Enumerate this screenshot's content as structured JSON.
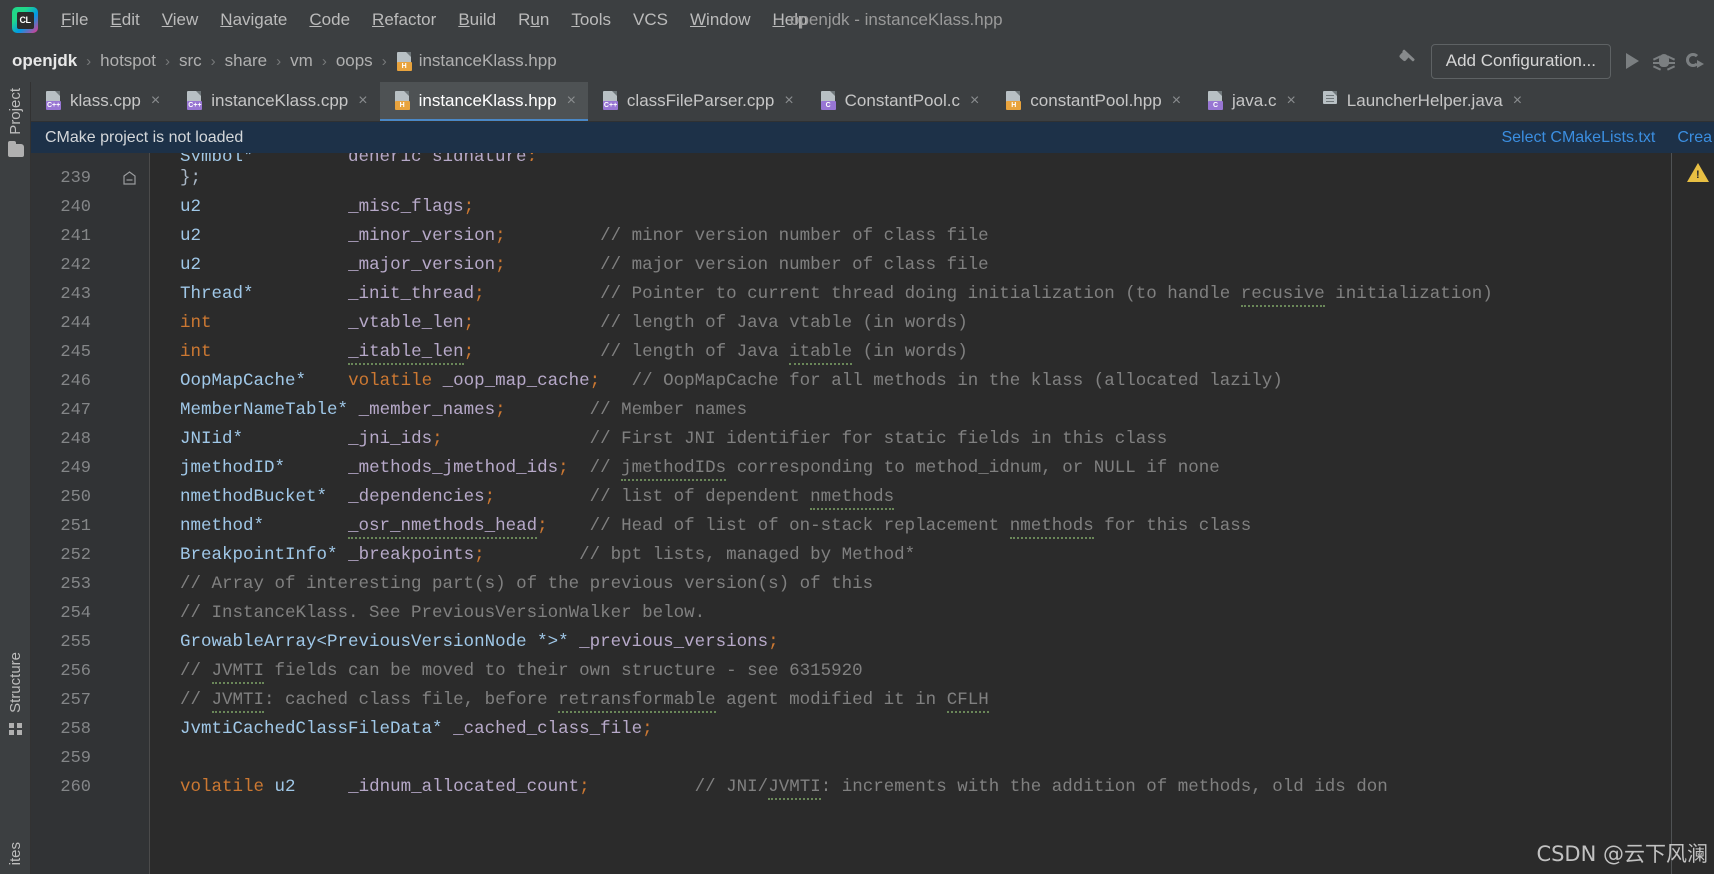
{
  "app": {
    "logo_text": "CL",
    "window_title": "openjdk - instanceKlass.hpp"
  },
  "menubar": {
    "items": [
      {
        "label": "File",
        "mnemonic": "F"
      },
      {
        "label": "Edit",
        "mnemonic": "E"
      },
      {
        "label": "View",
        "mnemonic": "V"
      },
      {
        "label": "Navigate",
        "mnemonic": "N"
      },
      {
        "label": "Code",
        "mnemonic": "C"
      },
      {
        "label": "Refactor",
        "mnemonic": "R"
      },
      {
        "label": "Build",
        "mnemonic": "B"
      },
      {
        "label": "Run",
        "mnemonic": "u"
      },
      {
        "label": "Tools",
        "mnemonic": "T"
      },
      {
        "label": "VCS",
        "mnemonic": ""
      },
      {
        "label": "Window",
        "mnemonic": "W"
      },
      {
        "label": "Help",
        "mnemonic": "H"
      }
    ]
  },
  "breadcrumb": {
    "separator": "›",
    "items": [
      "openjdk",
      "hotspot",
      "src",
      "share",
      "vm",
      "oops"
    ],
    "file": "instanceKlass.hpp",
    "file_icon": "h-file-icon"
  },
  "toolbar": {
    "build_icon": "hammer-icon",
    "add_configuration": "Add Configuration...",
    "run_icon": "run-icon",
    "debug_icon": "debug-bug-icon",
    "coverage_icon": "run-with-coverage-icon"
  },
  "tool_strip": {
    "project": "Project",
    "structure": "Structure",
    "favorites": "ites"
  },
  "tabs": [
    {
      "label": "klass.cpp",
      "icon": "cpp-file-icon",
      "badge": "C++",
      "badge_class": "cpp",
      "active": false
    },
    {
      "label": "instanceKlass.cpp",
      "icon": "cpp-file-icon",
      "badge": "C++",
      "badge_class": "cpp",
      "active": false
    },
    {
      "label": "instanceKlass.hpp",
      "icon": "h-file-icon",
      "badge": "H",
      "badge_class": "h",
      "active": true
    },
    {
      "label": "classFileParser.cpp",
      "icon": "cpp-file-icon",
      "badge": "C++",
      "badge_class": "cpp",
      "active": false
    },
    {
      "label": "ConstantPool.c",
      "icon": "c-file-icon",
      "badge": "C",
      "badge_class": "c",
      "active": false
    },
    {
      "label": "constantPool.hpp",
      "icon": "h-file-icon",
      "badge": "H",
      "badge_class": "h",
      "active": false
    },
    {
      "label": "java.c",
      "icon": "c-file-icon",
      "badge": "C",
      "badge_class": "c",
      "active": false
    },
    {
      "label": "LauncherHelper.java",
      "icon": "java-file-icon",
      "badge": "",
      "badge_class": "java",
      "active": false
    }
  ],
  "tab_close_glyph": "×",
  "notification": {
    "message": "CMake project is not loaded",
    "actions": [
      "Select CMakeLists.txt",
      "Crea"
    ]
  },
  "editor": {
    "first_line": 239,
    "fold_marker_line": 239,
    "warning_icon": "warning-triangle-icon",
    "lines": [
      {
        "num": 239,
        "fold": true,
        "tokens": [
          {
            "t": "  };",
            "c": "pn"
          }
        ]
      },
      {
        "num": 240,
        "tokens": [
          {
            "t": "  ",
            "c": "pn"
          },
          {
            "t": "u2",
            "c": "ty"
          },
          {
            "t": "              ",
            "c": "pn"
          },
          {
            "t": "_misc_flags",
            "c": "id"
          },
          {
            "t": ";",
            "c": "sc"
          }
        ]
      },
      {
        "num": 241,
        "tokens": [
          {
            "t": "  ",
            "c": "pn"
          },
          {
            "t": "u2",
            "c": "ty"
          },
          {
            "t": "              ",
            "c": "pn"
          },
          {
            "t": "_minor_version",
            "c": "id"
          },
          {
            "t": ";",
            "c": "sc"
          },
          {
            "t": "         ",
            "c": "pn"
          },
          {
            "t": "// minor version number of class file",
            "c": "cm"
          }
        ]
      },
      {
        "num": 242,
        "tokens": [
          {
            "t": "  ",
            "c": "pn"
          },
          {
            "t": "u2",
            "c": "ty"
          },
          {
            "t": "              ",
            "c": "pn"
          },
          {
            "t": "_major_version",
            "c": "id"
          },
          {
            "t": ";",
            "c": "sc"
          },
          {
            "t": "         ",
            "c": "pn"
          },
          {
            "t": "// major version number of class file",
            "c": "cm"
          }
        ]
      },
      {
        "num": 243,
        "tokens": [
          {
            "t": "  ",
            "c": "pn"
          },
          {
            "t": "Thread*",
            "c": "ty"
          },
          {
            "t": "         ",
            "c": "pn"
          },
          {
            "t": "_init_thread",
            "c": "id"
          },
          {
            "t": ";",
            "c": "sc"
          },
          {
            "t": "           ",
            "c": "pn"
          },
          {
            "t": "// Pointer to current thread doing initialization (to handle ",
            "c": "cm"
          },
          {
            "t": "recusive",
            "c": "cm sqc"
          },
          {
            "t": " initialization)",
            "c": "cm"
          }
        ]
      },
      {
        "num": 244,
        "tokens": [
          {
            "t": "  ",
            "c": "pn"
          },
          {
            "t": "int",
            "c": "k"
          },
          {
            "t": "             ",
            "c": "pn"
          },
          {
            "t": "_vtable_len",
            "c": "id"
          },
          {
            "t": ";",
            "c": "sc"
          },
          {
            "t": "            ",
            "c": "pn"
          },
          {
            "t": "// length of Java vtable (in words)",
            "c": "cm"
          }
        ]
      },
      {
        "num": 245,
        "tokens": [
          {
            "t": "  ",
            "c": "pn"
          },
          {
            "t": "int",
            "c": "k"
          },
          {
            "t": "             ",
            "c": "pn"
          },
          {
            "t": "_itable_len",
            "c": "id sq"
          },
          {
            "t": ";",
            "c": "sc"
          },
          {
            "t": "            ",
            "c": "pn"
          },
          {
            "t": "// length of Java ",
            "c": "cm"
          },
          {
            "t": "itable",
            "c": "cm sqc"
          },
          {
            "t": " (in words)",
            "c": "cm"
          }
        ]
      },
      {
        "num": 246,
        "tokens": [
          {
            "t": "  ",
            "c": "pn"
          },
          {
            "t": "OopMapCache*",
            "c": "ty"
          },
          {
            "t": "    ",
            "c": "pn"
          },
          {
            "t": "volatile",
            "c": "k"
          },
          {
            "t": " ",
            "c": "pn"
          },
          {
            "t": "_oop_map_cache",
            "c": "id"
          },
          {
            "t": ";",
            "c": "sc"
          },
          {
            "t": "   ",
            "c": "pn"
          },
          {
            "t": "// OopMapCache for all methods in the klass (allocated lazily)",
            "c": "cm"
          }
        ]
      },
      {
        "num": 247,
        "tokens": [
          {
            "t": "  ",
            "c": "pn"
          },
          {
            "t": "MemberNameTable*",
            "c": "ty"
          },
          {
            "t": " ",
            "c": "pn"
          },
          {
            "t": "_member_names",
            "c": "id"
          },
          {
            "t": ";",
            "c": "sc"
          },
          {
            "t": "        ",
            "c": "pn"
          },
          {
            "t": "// Member names",
            "c": "cm"
          }
        ]
      },
      {
        "num": 248,
        "tokens": [
          {
            "t": "  ",
            "c": "pn"
          },
          {
            "t": "JNIid*",
            "c": "ty"
          },
          {
            "t": "          ",
            "c": "pn"
          },
          {
            "t": "_jni_ids",
            "c": "id"
          },
          {
            "t": ";",
            "c": "sc"
          },
          {
            "t": "              ",
            "c": "pn"
          },
          {
            "t": "// First JNI identifier for static fields in this class",
            "c": "cm"
          }
        ]
      },
      {
        "num": 249,
        "tokens": [
          {
            "t": "  ",
            "c": "pn"
          },
          {
            "t": "jmethodID*",
            "c": "ty"
          },
          {
            "t": "      ",
            "c": "pn"
          },
          {
            "t": "_methods_jmethod_ids",
            "c": "id"
          },
          {
            "t": ";",
            "c": "sc"
          },
          {
            "t": "  ",
            "c": "pn"
          },
          {
            "t": "// ",
            "c": "cm"
          },
          {
            "t": "jmethodIDs",
            "c": "cm sqc"
          },
          {
            "t": " corresponding to method_idnum, or NULL if none",
            "c": "cm"
          }
        ]
      },
      {
        "num": 250,
        "tokens": [
          {
            "t": "  ",
            "c": "pn"
          },
          {
            "t": "nmethodBucket*",
            "c": "ty"
          },
          {
            "t": "  ",
            "c": "pn"
          },
          {
            "t": "_dependencies",
            "c": "id"
          },
          {
            "t": ";",
            "c": "sc"
          },
          {
            "t": "         ",
            "c": "pn"
          },
          {
            "t": "// list of dependent ",
            "c": "cm"
          },
          {
            "t": "nmethods",
            "c": "cm sqc"
          }
        ]
      },
      {
        "num": 251,
        "tokens": [
          {
            "t": "  ",
            "c": "pn"
          },
          {
            "t": "nmethod*",
            "c": "ty"
          },
          {
            "t": "        ",
            "c": "pn"
          },
          {
            "t": "_osr_nmethods_head",
            "c": "id sq"
          },
          {
            "t": ";",
            "c": "sc"
          },
          {
            "t": "    ",
            "c": "pn"
          },
          {
            "t": "// Head of list of on-stack replacement ",
            "c": "cm"
          },
          {
            "t": "nmethods",
            "c": "cm sqc"
          },
          {
            "t": " for this class",
            "c": "cm"
          }
        ]
      },
      {
        "num": 252,
        "tokens": [
          {
            "t": "  ",
            "c": "pn"
          },
          {
            "t": "BreakpointInfo*",
            "c": "ty"
          },
          {
            "t": " ",
            "c": "pn"
          },
          {
            "t": "_breakpoints",
            "c": "id"
          },
          {
            "t": ";",
            "c": "sc"
          },
          {
            "t": "         ",
            "c": "pn"
          },
          {
            "t": "// bpt lists, managed by Method*",
            "c": "cm"
          }
        ]
      },
      {
        "num": 253,
        "tokens": [
          {
            "t": "  ",
            "c": "pn"
          },
          {
            "t": "// Array of interesting part(s) of the previous version(s) of this",
            "c": "cm"
          }
        ]
      },
      {
        "num": 254,
        "tokens": [
          {
            "t": "  ",
            "c": "pn"
          },
          {
            "t": "// InstanceKlass. See PreviousVersionWalker below.",
            "c": "cm"
          }
        ]
      },
      {
        "num": 255,
        "tokens": [
          {
            "t": "  ",
            "c": "pn"
          },
          {
            "t": "GrowableArray<PreviousVersionNode *>*",
            "c": "ty"
          },
          {
            "t": " ",
            "c": "pn"
          },
          {
            "t": "_previous_versions",
            "c": "id"
          },
          {
            "t": ";",
            "c": "sc"
          }
        ]
      },
      {
        "num": 256,
        "tokens": [
          {
            "t": "  ",
            "c": "pn"
          },
          {
            "t": "// ",
            "c": "cm"
          },
          {
            "t": "JVMTI",
            "c": "cm sqc"
          },
          {
            "t": " fields can be moved to their own structure - see 6315920",
            "c": "cm"
          }
        ]
      },
      {
        "num": 257,
        "tokens": [
          {
            "t": "  ",
            "c": "pn"
          },
          {
            "t": "// ",
            "c": "cm"
          },
          {
            "t": "JVMTI",
            "c": "cm sqc"
          },
          {
            "t": ": cached class file, before ",
            "c": "cm"
          },
          {
            "t": "retransformable",
            "c": "cm sqc"
          },
          {
            "t": " agent modified it in ",
            "c": "cm"
          },
          {
            "t": "CFLH",
            "c": "cm sqc"
          }
        ]
      },
      {
        "num": 258,
        "tokens": [
          {
            "t": "  ",
            "c": "pn"
          },
          {
            "t": "JvmtiCachedClassFileData*",
            "c": "ty"
          },
          {
            "t": " ",
            "c": "pn"
          },
          {
            "t": "_cached_class_file",
            "c": "id"
          },
          {
            "t": ";",
            "c": "sc"
          }
        ]
      },
      {
        "num": 259,
        "tokens": []
      },
      {
        "num": 260,
        "tokens": [
          {
            "t": "  ",
            "c": "pn"
          },
          {
            "t": "volatile",
            "c": "k"
          },
          {
            "t": " ",
            "c": "pn"
          },
          {
            "t": "u2",
            "c": "ty"
          },
          {
            "t": "     ",
            "c": "pn"
          },
          {
            "t": "_idnum_allocated_count",
            "c": "id"
          },
          {
            "t": ";",
            "c": "sc"
          },
          {
            "t": "          ",
            "c": "pn"
          },
          {
            "t": "// JNI/",
            "c": "cm"
          },
          {
            "t": "JVMTI",
            "c": "cm sqc"
          },
          {
            "t": ": increments with the addition of methods, old ids don",
            "c": "cm"
          }
        ]
      }
    ]
  },
  "watermark": "CSDN @云下风澜",
  "colors": {
    "chrome": "#3c3f41",
    "editor_bg": "#2b2b2b",
    "gutter_bg": "#313335",
    "notification_bg": "#1d3148",
    "accent_link": "#3b8ee0",
    "tab_active_underline": "#4a88c7",
    "keyword": "#cc7832",
    "type": "#a0c8e8",
    "identifier": "#b7a9c9",
    "comment": "#808080",
    "warning": "#e8bf43"
  }
}
